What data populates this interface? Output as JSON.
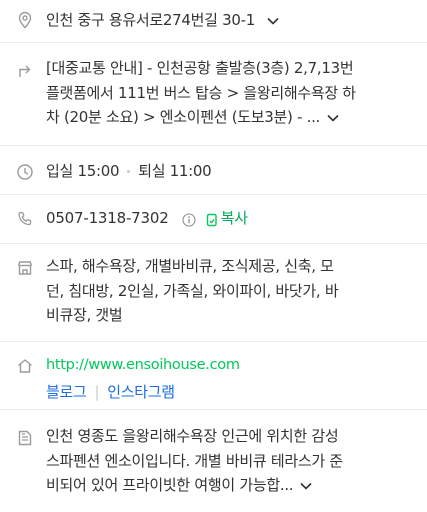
{
  "address": {
    "text": "인천 중구 용유서로274번길 30-1"
  },
  "transport": {
    "lines": [
      "[대중교통 안내] - 인천공항 출발층(3층) 2,7,13번",
      "플랫폼에서 111번 버스 탑승 > 을왕리해수욕장 하",
      "차 (20분 소요) > 엔소이펜션 (도보3분) - ..."
    ]
  },
  "hours": {
    "checkin": "입실 15:00",
    "checkout": "퇴실 11:00"
  },
  "phone": {
    "number": "0507-1318-7302",
    "copy_label": "복사"
  },
  "facilities": {
    "lines": [
      "스파, 해수욕장, 개별바비큐, 조식제공, 신축, 모",
      "던, 침대방, 2인실, 가족실, 와이파이, 바닷가, 바",
      "비큐장, 갯벌"
    ]
  },
  "website": {
    "url": "http://www.ensoihouse.com",
    "links": [
      "블로그",
      "인스타그램"
    ]
  },
  "description": {
    "lines": [
      "인천 영종도 을왕리해수욕장 인근에 위치한 감성",
      "스파펜션 엔소이입니다. 개별 바비큐 테라스가 준",
      "비되어 있어 프라이빗한 여행이 가능합..."
    ]
  },
  "colors": {
    "icon": "#9b9b9b",
    "green": "#03c75a",
    "link": "#1c6de0"
  }
}
